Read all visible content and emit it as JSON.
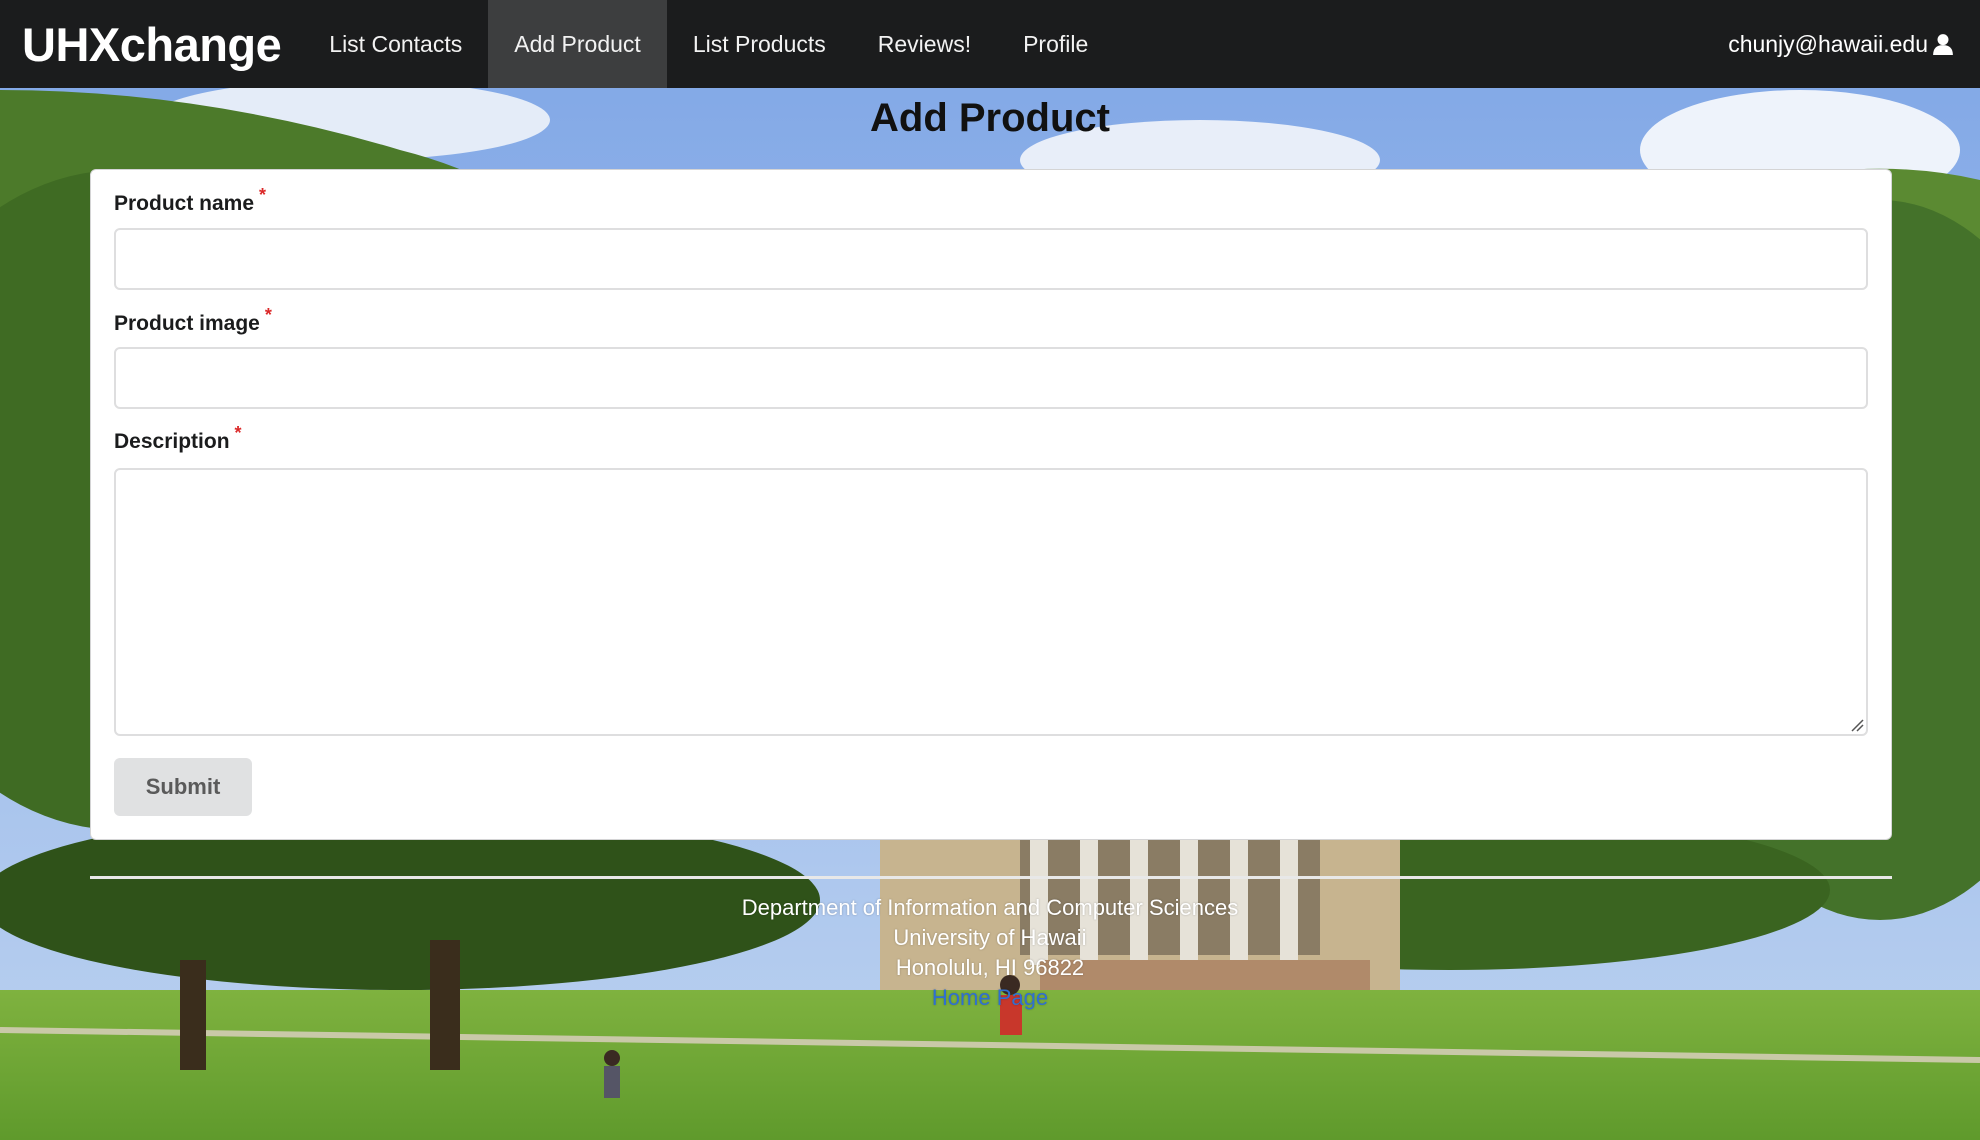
{
  "nav": {
    "brand": "UHXchange",
    "items": [
      {
        "label": "List Contacts",
        "active": false
      },
      {
        "label": "Add Product",
        "active": true
      },
      {
        "label": "List Products",
        "active": false
      },
      {
        "label": "Reviews!",
        "active": false
      },
      {
        "label": "Profile",
        "active": false
      }
    ],
    "user_email": "chunjy@hawaii.edu",
    "user_icon": "user-icon"
  },
  "page": {
    "title": "Add Product"
  },
  "form": {
    "fields": [
      {
        "label": "Product name",
        "required_mark": "*",
        "value": ""
      },
      {
        "label": "Product image",
        "required_mark": "*",
        "value": ""
      },
      {
        "label": "Description",
        "required_mark": "*",
        "value": ""
      }
    ],
    "submit_label": "Submit"
  },
  "footer": {
    "line1": "Department of Information and Computer Sciences",
    "line2": "University of Hawaii",
    "line3": "Honolulu, HI 96822",
    "link": "Home Page"
  },
  "colors": {
    "navbar": "#1b1c1d",
    "nav_active": "#3d3e3f",
    "required": "#db2828",
    "link": "#2f6fd1"
  }
}
